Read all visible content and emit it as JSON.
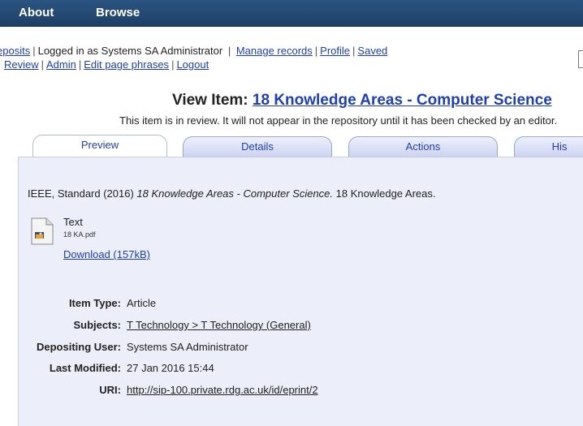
{
  "topnav": {
    "about": "About",
    "browse": "Browse"
  },
  "loginbar": {
    "deposits": "eposits",
    "logged_in": "Logged in as Systems SA Administrator",
    "manage_records": "Manage records",
    "profile": "Profile",
    "saved": "Saved",
    "review": "Review",
    "admin": "Admin",
    "edit_phrases": "Edit page phrases",
    "logout": "Logout"
  },
  "title": {
    "prefix": "View Item: ",
    "item": "18 Knowledge Areas - Computer Science"
  },
  "review_note": "This item is in review. It will not appear in the repository until it has been checked by an editor.",
  "tabs": [
    {
      "label": "Preview",
      "active": true
    },
    {
      "label": "Details"
    },
    {
      "label": "Actions"
    },
    {
      "label": "His"
    }
  ],
  "citation": {
    "pre": "IEEE, Standard (2016) ",
    "title": "18 Knowledge Areas - Computer Science.",
    "post": " 18 Knowledge Areas."
  },
  "document": {
    "icon": "document-image-icon",
    "type": "Text",
    "filename": "18 KA.pdf",
    "download": "Download (157kB)"
  },
  "metadata": {
    "item_type": {
      "label": "Item Type:",
      "value": "Article"
    },
    "subjects": {
      "label": "Subjects:",
      "value": "T Technology > T Technology (General)"
    },
    "depositing_user": {
      "label": "Depositing User:",
      "value": "Systems SA Administrator"
    },
    "last_modified": {
      "label": "Last Modified:",
      "value": "27 Jan 2016 15:44"
    },
    "uri": {
      "label": "URI:",
      "value": "http://sip-100.private.rdg.ac.uk/id/eprint/2"
    }
  },
  "colors": {
    "nav_bg": "#1d3f66",
    "link": "#1f3fb0",
    "panel_bg": "#eceef9"
  }
}
